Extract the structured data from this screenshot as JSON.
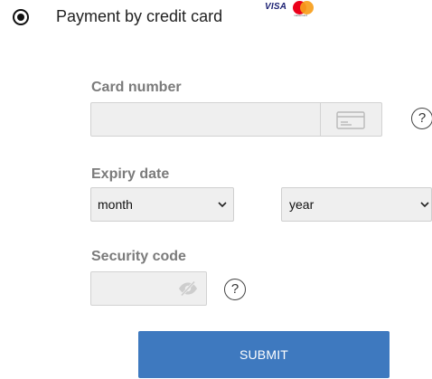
{
  "payment_option": {
    "label": "Payment by credit card",
    "selected": true,
    "brands": {
      "visa_text": "VISA",
      "mastercard_text": "mastercard"
    }
  },
  "card_number": {
    "label": "Card number",
    "value": "",
    "placeholder": "",
    "icon": "credit-card-icon",
    "help": "?"
  },
  "expiry": {
    "label": "Expiry date",
    "month_value": "month",
    "year_value": "year"
  },
  "security_code": {
    "label": "Security code",
    "value": "",
    "placeholder": "",
    "icon": "eye-slash-icon",
    "help": "?"
  },
  "submit": {
    "label": "SUBMIT"
  },
  "colors": {
    "accent": "#3e79bf",
    "label": "#7b7b7b",
    "field_bg": "#efefef",
    "visa": "#1a1f71",
    "mastercard_red": "#eb001b",
    "mastercard_orange": "#f79e1b"
  }
}
